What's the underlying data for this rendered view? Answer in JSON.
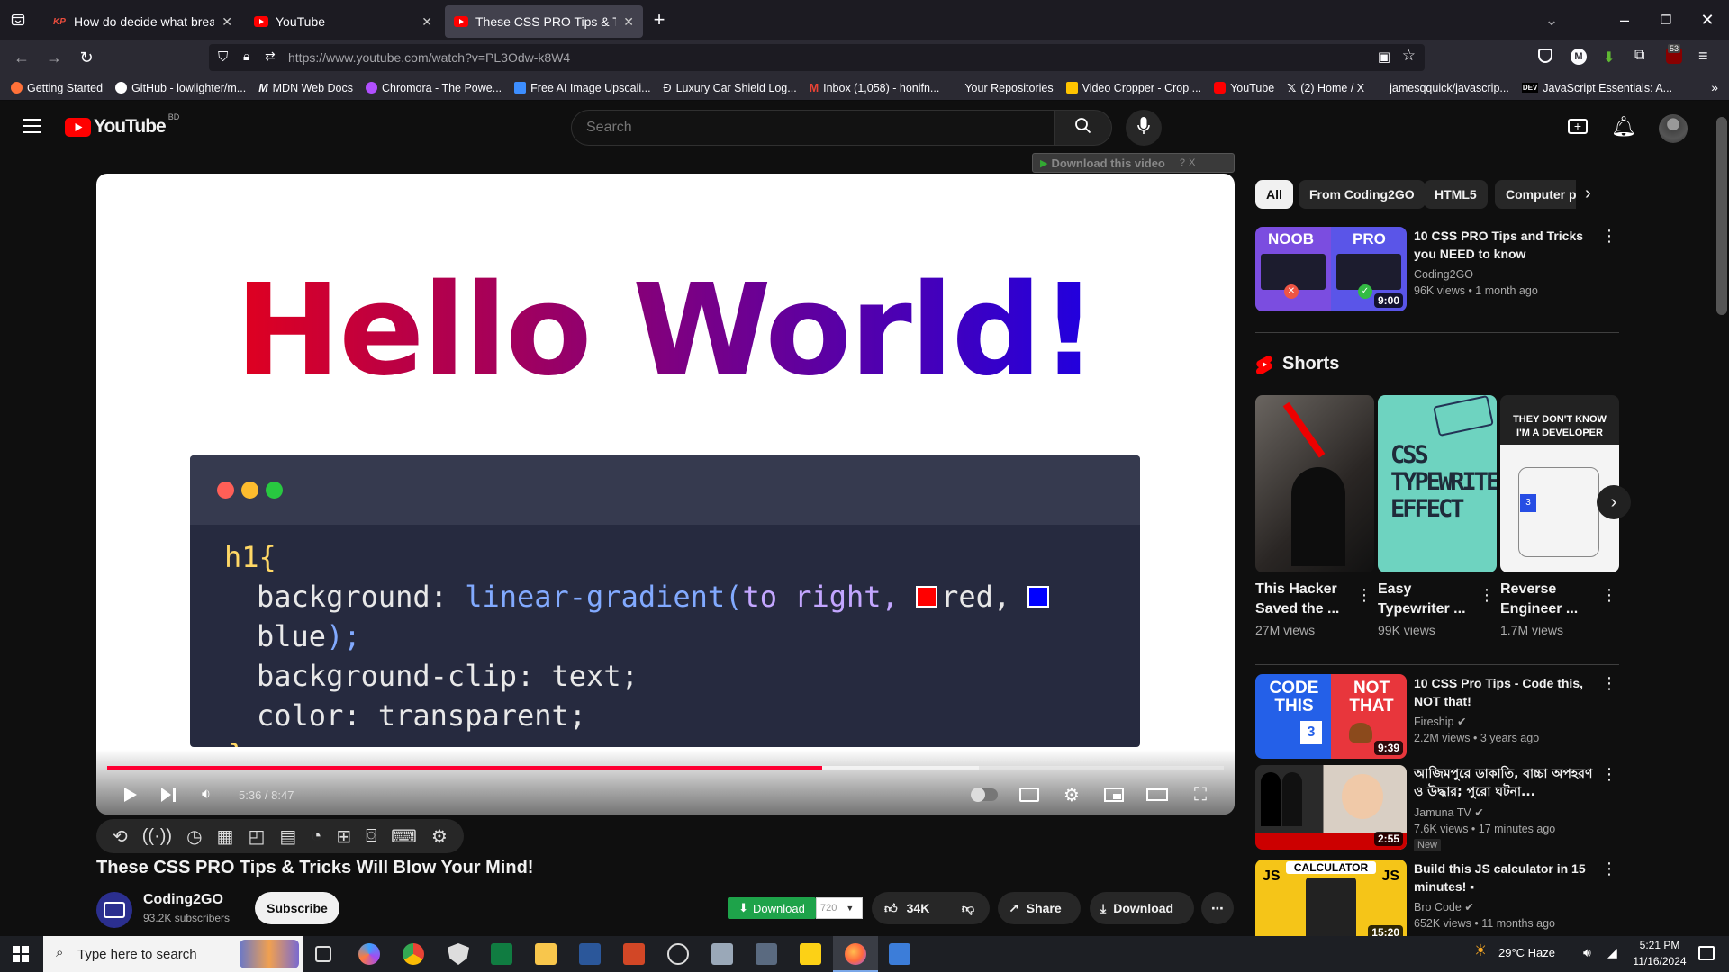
{
  "browser": {
    "tabs": [
      {
        "label": "How do decide what breakpoin",
        "icon": "KP"
      },
      {
        "label": "YouTube",
        "icon": "yt"
      },
      {
        "label": "These CSS PRO Tips & Tricks Wi",
        "icon": "yt"
      }
    ],
    "url": "https://www.youtube.com/watch?v=PL3Odw-k8W4",
    "ext_badge": "53",
    "bookmarks": [
      "Getting Started",
      "GitHub - lowlighter/m...",
      "MDN Web Docs",
      "Chromora - The Powe...",
      "Free AI Image Upscali...",
      "Luxury Car Shield Log...",
      "Inbox (1,058) - honifn...",
      "Your Repositories",
      "Video Cropper - Crop ...",
      "YouTube",
      "(2) Home / X",
      "jamesqquick/javascrip...",
      "JavaScript Essentials: A..."
    ]
  },
  "youtube": {
    "logo": "YouTube",
    "region": "BD",
    "search_placeholder": "Search",
    "download_bar": "Download this video",
    "player": {
      "headline": "Hello World!",
      "code": {
        "l1": "h1{",
        "bg_prop": "background: ",
        "bg_fn": "linear-gradient(",
        "bg_to": "to right, ",
        "red": "red, ",
        "blue": "blue",
        "bg_end": ");",
        "l3": "background-clip: text;",
        "l4": "color: transparent;",
        "l5": "}"
      },
      "time": "5:36 / 8:47",
      "progress_fraction": 0.64
    },
    "video_title": "These CSS PRO Tips & Tricks Will Blow Your Mind!",
    "channel": {
      "name": "Coding2GO",
      "subs": "93.2K subscribers",
      "subscribe": "Subscribe"
    },
    "actions": {
      "download_ext": "Download",
      "quality": "720",
      "likes": "34K",
      "share": "Share",
      "download": "Download"
    },
    "chips": [
      "All",
      "From Coding2GO",
      "HTML5",
      "Computer p"
    ],
    "related_top": {
      "title": "10 CSS PRO Tips and Tricks you NEED to know",
      "channel": "Coding2GO",
      "meta": "96K views  •  1 month ago",
      "duration": "9:00",
      "noob": "NOOB",
      "pro": "PRO"
    },
    "shorts_heading": "Shorts",
    "shorts": [
      {
        "title": "This Hacker Saved the ...",
        "views": "27M views"
      },
      {
        "title": "Easy Typewriter ...",
        "views": "99K views",
        "thumb_text": "CSS TYPEWRITER EFFECT"
      },
      {
        "title": "Reverse Engineer ...",
        "views": "1.7M views",
        "thumb_text": "THEY DON'T KNOW I'M A DEVELOPER"
      }
    ],
    "related": [
      {
        "title": "10 CSS Pro Tips - Code this, NOT that!",
        "channel": "Fireship",
        "meta": "2.2M views  •  3 years ago",
        "duration": "9:39",
        "thumb_a": "CODE THIS",
        "thumb_b": "NOT THAT"
      },
      {
        "title": "আজিমপুরে ডাকাতি, বাচ্চা অপহরণ ও উদ্ধার; পুরো ঘটনা...",
        "channel": "Jamuna TV",
        "meta": "7.6K views  •  17 minutes ago",
        "badge": "New",
        "duration": "2:55"
      },
      {
        "title": "Build this JS calculator in 15 minutes! ▪",
        "channel": "Bro Code",
        "meta": "652K views  •  11 months ago",
        "duration": "15:20",
        "thumb_a": "JS",
        "thumb_b": "CALCULATOR"
      }
    ]
  },
  "taskbar": {
    "search": "Type here to search",
    "weather": "29°C  Haze",
    "time": "5:21 PM",
    "date": "11/16/2024"
  }
}
